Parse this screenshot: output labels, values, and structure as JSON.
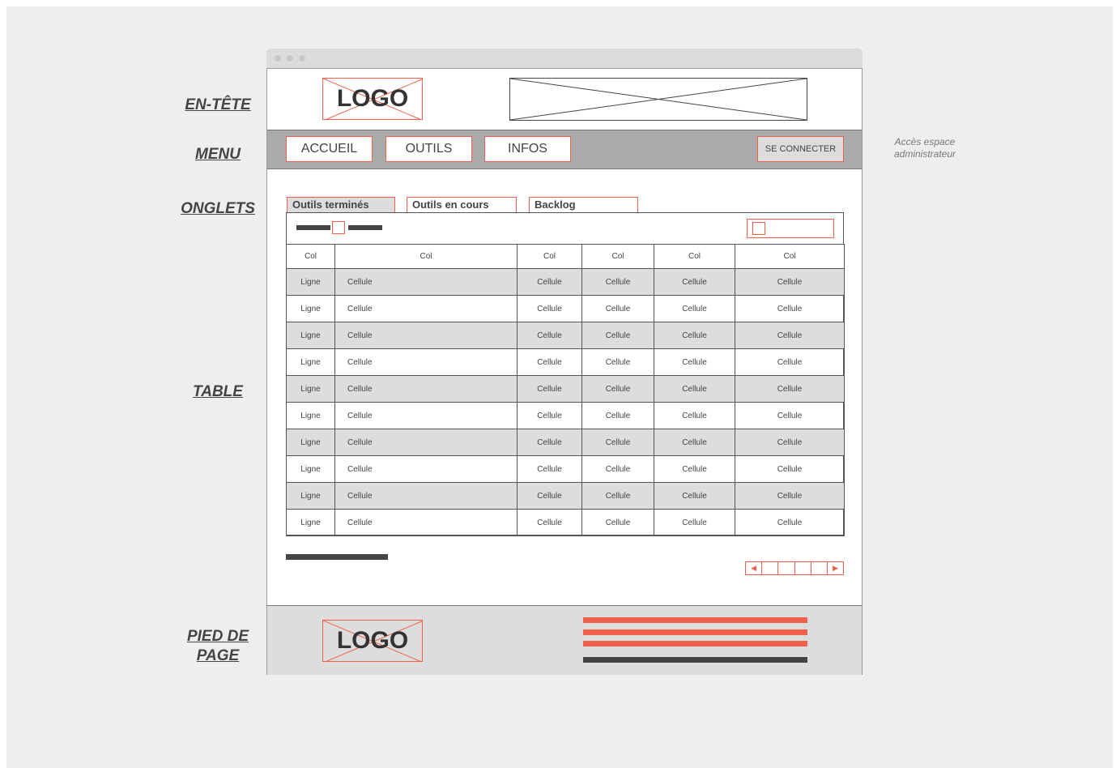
{
  "labels": {
    "header": "EN-TÊTE",
    "menu": "MENU",
    "tabs": "ONGLETS",
    "table": "TABLE",
    "footer_line1": "PIED DE",
    "footer_line2": "PAGE"
  },
  "note": {
    "line1": "Accès espace",
    "line2": "administrateur"
  },
  "header": {
    "logo": "LOGO"
  },
  "menu": {
    "items": [
      "ACCUEIL",
      "OUTILS",
      "INFOS"
    ],
    "login": "SE CONNECTER"
  },
  "tabs": [
    "Outils terminés",
    "Outils en cours",
    "Backlog"
  ],
  "table": {
    "columns": [
      "Col",
      "Col",
      "Col",
      "Col",
      "Col",
      "Col"
    ],
    "rows": [
      [
        "Ligne",
        "Cellule",
        "Cellule",
        "Cellule",
        "Cellule",
        "Cellule"
      ],
      [
        "Ligne",
        "Cellule",
        "Cellule",
        "Cellule",
        "Cellule",
        "Cellule"
      ],
      [
        "Ligne",
        "Cellule",
        "Cellule",
        "Cellule",
        "Cellule",
        "Cellule"
      ],
      [
        "Ligne",
        "Cellule",
        "Cellule",
        "Cellule",
        "Cellule",
        "Cellule"
      ],
      [
        "Ligne",
        "Cellule",
        "Cellule",
        "Cellule",
        "Cellule",
        "Cellule"
      ],
      [
        "Ligne",
        "Cellule",
        "Cellule",
        "Cellule",
        "Cellule",
        "Cellule"
      ],
      [
        "Ligne",
        "Cellule",
        "Cellule",
        "Cellule",
        "Cellule",
        "Cellule"
      ],
      [
        "Ligne",
        "Cellule",
        "Cellule",
        "Cellule",
        "Cellule",
        "Cellule"
      ],
      [
        "Ligne",
        "Cellule",
        "Cellule",
        "Cellule",
        "Cellule",
        "Cellule"
      ],
      [
        "Ligne",
        "Cellule",
        "Cellule",
        "Cellule",
        "Cellule",
        "Cellule"
      ]
    ]
  },
  "pager": {
    "prev": "◀",
    "next": "▶"
  },
  "footer": {
    "logo": "LOGO"
  },
  "colors": {
    "accent": "#f16149",
    "dark": "#444444",
    "menu_bg": "#aaaaaa",
    "shade": "#dddddd"
  }
}
